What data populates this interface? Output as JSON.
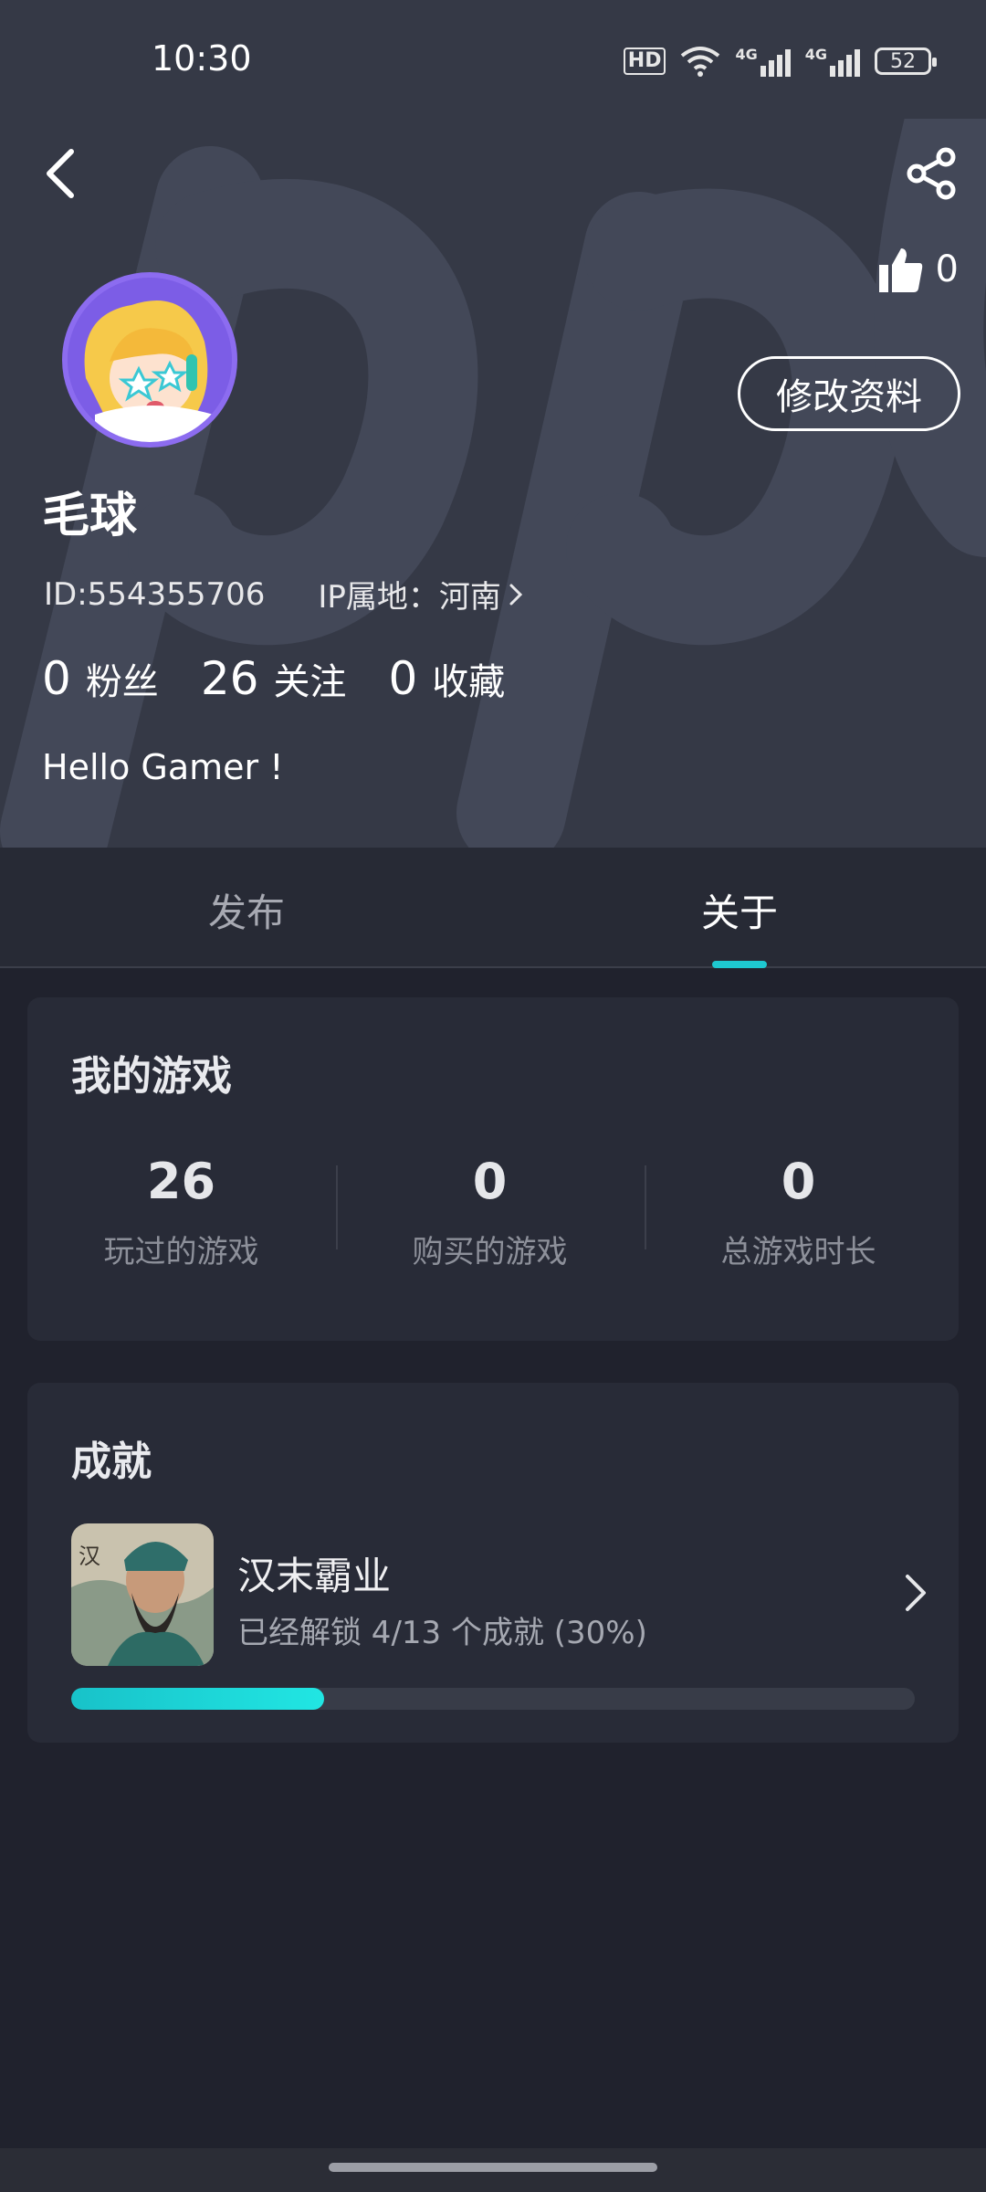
{
  "status_bar": {
    "time": "10:30",
    "hd_label": "HD",
    "net1": "4G",
    "net2": "4G",
    "battery": "52"
  },
  "header": {
    "likes": "0",
    "edit_label": "修改资料",
    "name": "毛球",
    "id_text": "ID:554355706",
    "ip_text": "IP属地：河南",
    "stats": [
      {
        "value": "0",
        "label": "粉丝"
      },
      {
        "value": "26",
        "label": "关注"
      },
      {
        "value": "0",
        "label": "收藏"
      }
    ],
    "bio": "Hello Gamer !"
  },
  "tabs": [
    {
      "label": "发布",
      "active": false
    },
    {
      "label": "关于",
      "active": true
    }
  ],
  "my_games": {
    "title": "我的游戏",
    "metrics": [
      {
        "value": "26",
        "label": "玩过的游戏"
      },
      {
        "value": "0",
        "label": "购买的游戏"
      },
      {
        "value": "0",
        "label": "总游戏时长"
      }
    ]
  },
  "achievements": {
    "title": "成就",
    "game": {
      "name": "汉末霸业",
      "progress_text": "已经解锁 4/13 个成就 (30%)",
      "progress_fraction": 0.3
    }
  },
  "colors": {
    "accent": "#1ec8d0",
    "header_bg": "#353946",
    "page_bg": "#20222d",
    "card_bg": "#282b37"
  }
}
